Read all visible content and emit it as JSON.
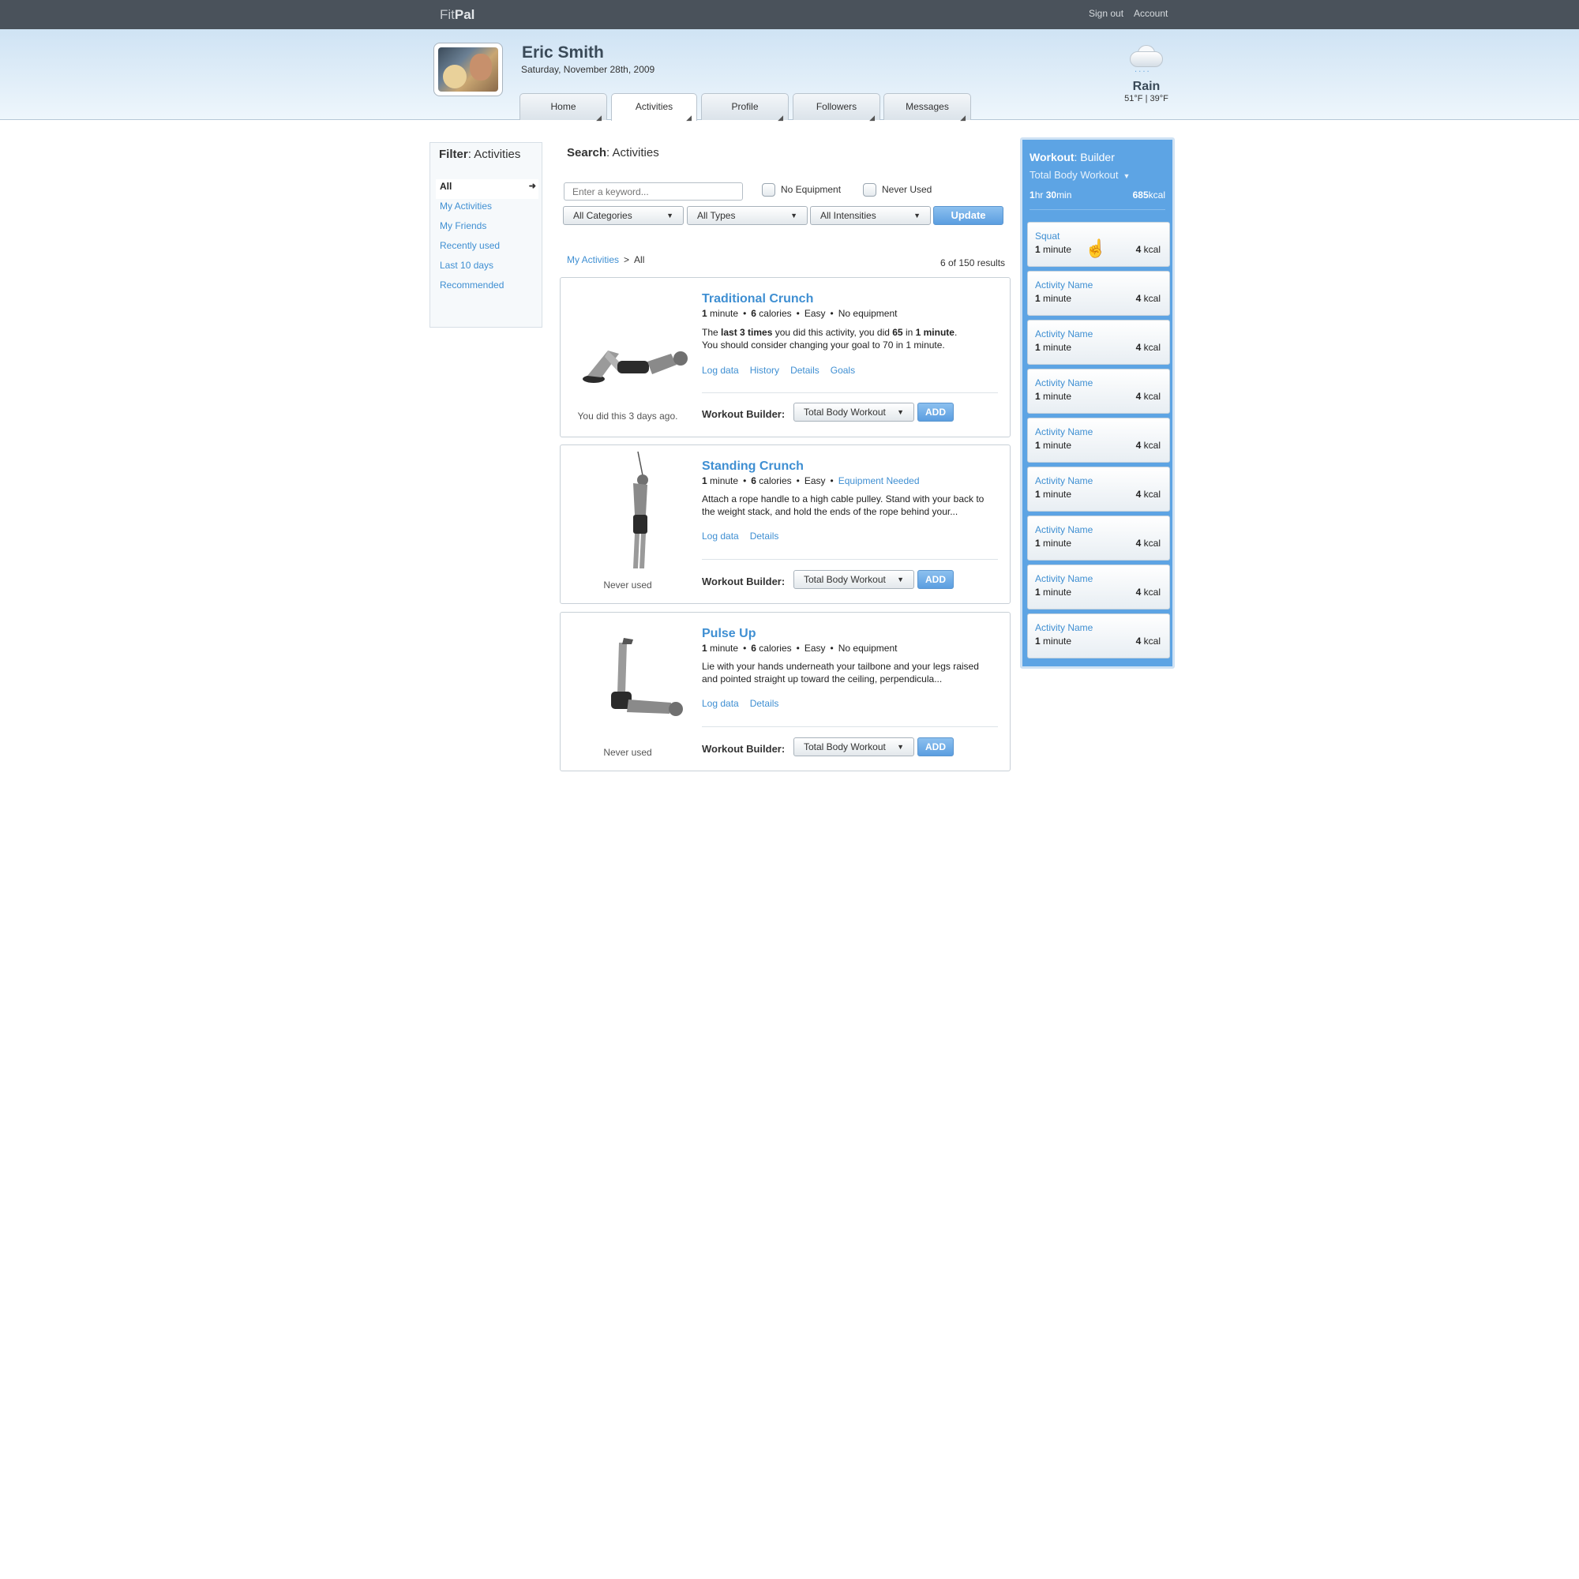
{
  "app": {
    "logo_part1": "Fit",
    "logo_part2": "Pal",
    "signout": "Sign out",
    "account": "Account"
  },
  "user": {
    "name": "Eric Smith",
    "date": "Saturday, November 28th, 2009"
  },
  "tabs": [
    {
      "label": "Home"
    },
    {
      "label": "Activities"
    },
    {
      "label": "Profile"
    },
    {
      "label": "Followers"
    },
    {
      "label": "Messages"
    }
  ],
  "weather": {
    "condition": "Rain",
    "temps": "51°F | 39°F",
    "icon": "rain-cloud-icon"
  },
  "filter": {
    "title_bold": "Filter",
    "title_rest": ": Activities",
    "items": [
      {
        "label": "All"
      },
      {
        "label": "My Activities"
      },
      {
        "label": "My Friends"
      },
      {
        "label": "Recently used"
      },
      {
        "label": "Last 10 days"
      },
      {
        "label": "Recommended"
      }
    ]
  },
  "search": {
    "title_bold": "Search",
    "title_rest": ": Activities",
    "placeholder": "Enter a keyword...",
    "no_equipment": "No Equipment",
    "never_used": "Never Used",
    "categories": "All Categories",
    "types": "All Types",
    "intensities": "All Intensities",
    "update": "Update"
  },
  "breadcrumb": {
    "root": "My Activities",
    "sep": ">",
    "current": "All"
  },
  "results": "6 of 150 results",
  "activities": [
    {
      "name": "Traditional Crunch",
      "duration_num": "1",
      "duration_unit": "minute",
      "calories_num": "6",
      "calories_unit": "calories",
      "difficulty": "Easy",
      "equipment": "No equipment",
      "desc_1": "The ",
      "desc_b1": "last 3 times",
      "desc_2": " you did this activity, you did ",
      "desc_b2": "65",
      "desc_3": " in ",
      "desc_b3": "1 minute",
      "desc_4": ".",
      "desc_line2": "You should consider changing your goal to 70 in 1 minute.",
      "links": [
        "Log data",
        "History",
        "Details",
        "Goals"
      ],
      "caption": "You did this 3 days ago.",
      "wb_label": "Workout Builder:",
      "wb_select": "Total Body Workout",
      "add": "ADD"
    },
    {
      "name": "Standing Crunch",
      "duration_num": "1",
      "duration_unit": "minute",
      "calories_num": "6",
      "calories_unit": "calories",
      "difficulty": "Easy",
      "equipment": "Equipment Needed",
      "desc": "Attach a rope handle to a high cable pulley. Stand with your back to the weight stack, and hold the ends of the rope behind your...",
      "links": [
        "Log data",
        "Details"
      ],
      "caption": "Never used",
      "wb_label": "Workout Builder:",
      "wb_select": "Total Body Workout",
      "add": "ADD"
    },
    {
      "name": "Pulse Up",
      "duration_num": "1",
      "duration_unit": "minute",
      "calories_num": "6",
      "calories_unit": "calories",
      "difficulty": "Easy",
      "equipment": "No equipment",
      "desc": "Lie with your hands underneath your tailbone and your legs raised and pointed straight up toward the ceiling, perpendicula...",
      "links": [
        "Log data",
        "Details"
      ],
      "caption": "Never used",
      "wb_label": "Workout Builder:",
      "wb_select": "Total Body Workout",
      "add": "ADD"
    }
  ],
  "builder": {
    "title_bold": "Workout",
    "title_rest": ": Builder",
    "plan": "Total Body Workout",
    "time_h": "1",
    "time_h_unit": "hr",
    "time_m": "30",
    "time_m_unit": "min",
    "kcal_num": "685",
    "kcal_unit": "kcal",
    "items": [
      {
        "name": "Squat",
        "dur_num": "1",
        "dur_unit": "minute",
        "kcal_num": "4",
        "kcal_unit": "kcal"
      },
      {
        "name": "Activity Name",
        "dur_num": "1",
        "dur_unit": "minute",
        "kcal_num": "4",
        "kcal_unit": "kcal"
      },
      {
        "name": "Activity Name",
        "dur_num": "1",
        "dur_unit": "minute",
        "kcal_num": "4",
        "kcal_unit": "kcal"
      },
      {
        "name": "Activity Name",
        "dur_num": "1",
        "dur_unit": "minute",
        "kcal_num": "4",
        "kcal_unit": "kcal"
      },
      {
        "name": "Activity Name",
        "dur_num": "1",
        "dur_unit": "minute",
        "kcal_num": "4",
        "kcal_unit": "kcal"
      },
      {
        "name": "Activity Name",
        "dur_num": "1",
        "dur_unit": "minute",
        "kcal_num": "4",
        "kcal_unit": "kcal"
      },
      {
        "name": "Activity Name",
        "dur_num": "1",
        "dur_unit": "minute",
        "kcal_num": "4",
        "kcal_unit": "kcal"
      },
      {
        "name": "Activity Name",
        "dur_num": "1",
        "dur_unit": "minute",
        "kcal_num": "4",
        "kcal_unit": "kcal"
      },
      {
        "name": "Activity Name",
        "dur_num": "1",
        "dur_unit": "minute",
        "kcal_num": "4",
        "kcal_unit": "kcal"
      }
    ]
  },
  "colors": {
    "topbar": "#4a525b",
    "link": "#3f8fd2",
    "builder": "#5da4e4",
    "button": "#5b9ee0"
  }
}
